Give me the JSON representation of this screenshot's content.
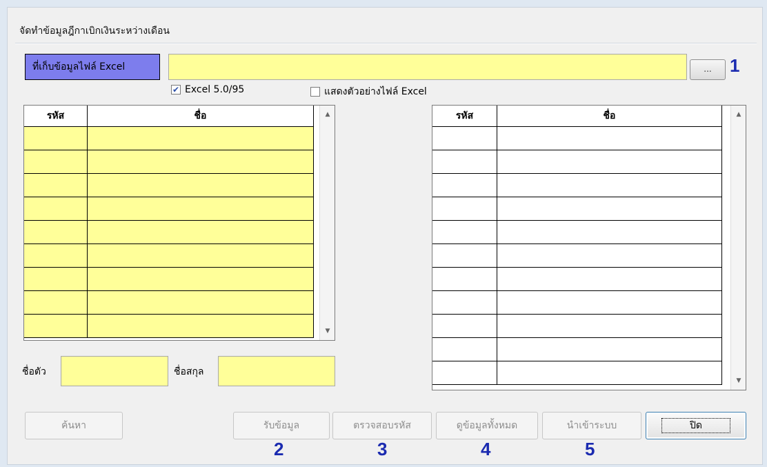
{
  "window": {
    "title": "จัดทำข้อมูลฎีกาเบิกเงินระหว่างเดือน"
  },
  "file": {
    "label": "ที่เก็บข้อมูลไฟล์ Excel",
    "path_value": "",
    "browse_label": "..."
  },
  "steps": {
    "s1": "1",
    "s2": "2",
    "s3": "3",
    "s4": "4",
    "s5": "5"
  },
  "options": {
    "excel95": {
      "label": "Excel 5.0/95",
      "checked": true
    },
    "preview": {
      "label": "แสดงตัวอย่างไฟล์ Excel",
      "checked": false
    }
  },
  "left_grid": {
    "columns": [
      "รหัส",
      "ชื่อ"
    ],
    "row_count": 9
  },
  "right_grid": {
    "columns": [
      "รหัส",
      "ชื่อ"
    ],
    "row_count": 11
  },
  "name_fields": {
    "first_label": "ชื่อตัว",
    "last_label": "ชื่อสกุล",
    "first_value": "",
    "last_value": ""
  },
  "buttons": {
    "search": "ค้นหา",
    "get_data": "รับข้อมูล",
    "check_code": "ตรวจสอบรหัส",
    "view_all": "ดูข้อมูลทั้งหมด",
    "import": "นำเข้าระบบ",
    "close": "ปิด"
  },
  "colors": {
    "yellow": "#ffff99",
    "label_blue": "#7d7ded",
    "step_blue": "#1b2bb0"
  }
}
